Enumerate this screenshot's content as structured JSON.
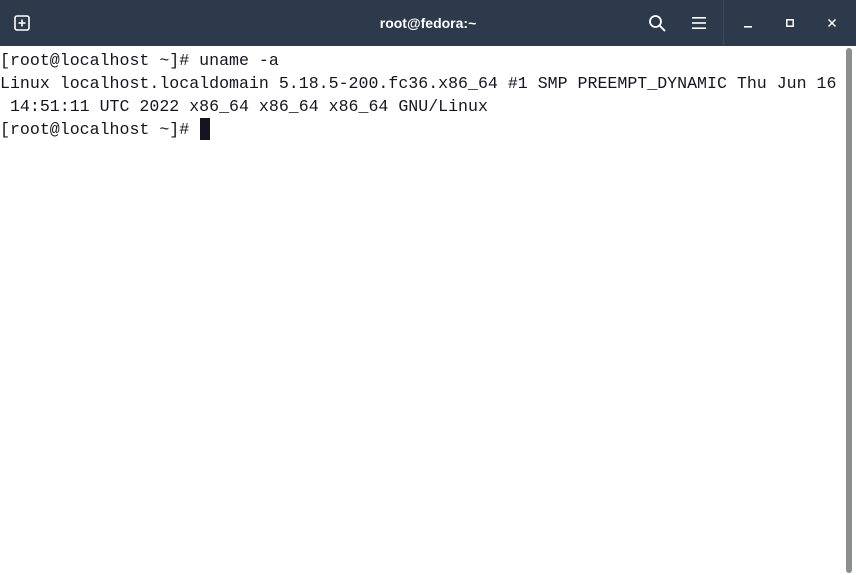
{
  "window": {
    "title": "root@fedora:~"
  },
  "titlebar": {
    "new_tab_icon": "new-tab-icon",
    "search_icon": "search-icon",
    "menu_icon": "hamburger-menu-icon",
    "minimize_icon": "minimize-icon",
    "maximize_icon": "maximize-icon",
    "close_icon": "close-icon",
    "bg_color": "#2d3a4b"
  },
  "terminal": {
    "lines": [
      "[root@localhost ~]# uname -a",
      "Linux localhost.localdomain 5.18.5-200.fc36.x86_64 #1 SMP PREEMPT_DYNAMIC Thu Jun 16",
      " 14:51:11 UTC 2022 x86_64 x86_64 x86_64 GNU/Linux",
      "[root@localhost ~]# "
    ],
    "fg_color": "#171421",
    "bg_color": "#ffffff"
  }
}
